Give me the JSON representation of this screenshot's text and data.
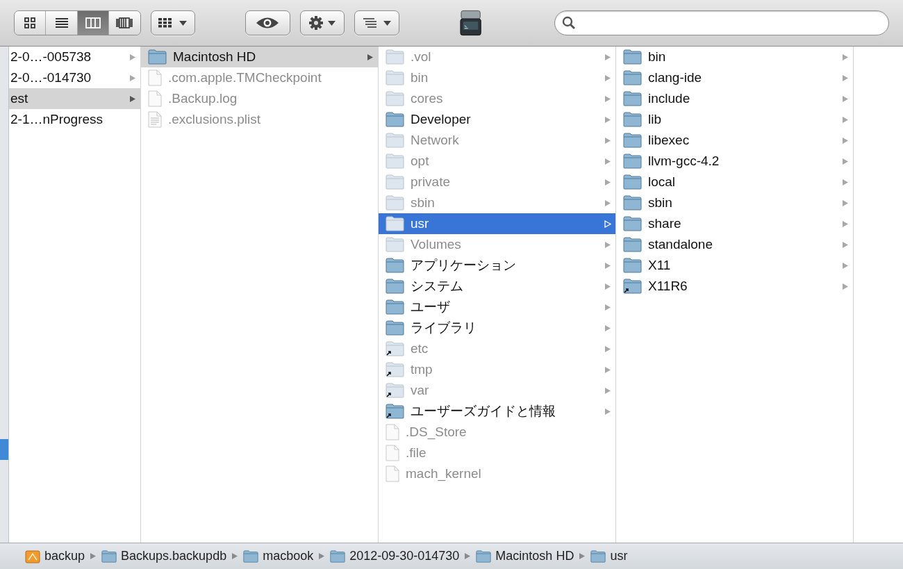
{
  "toolbar": {
    "view_buttons": [
      {
        "kind": "icons",
        "selected": false
      },
      {
        "kind": "list",
        "selected": false
      },
      {
        "kind": "columns",
        "selected": true
      },
      {
        "kind": "coverflow",
        "selected": false
      }
    ]
  },
  "columns": [
    {
      "focused": false,
      "items": [
        {
          "name": "2-0…-005738",
          "kind": "none",
          "dimmed": false,
          "selected": false,
          "arrow": true
        },
        {
          "name": "2-0…-014730",
          "kind": "none",
          "dimmed": false,
          "selected": false,
          "arrow": true
        },
        {
          "name": "est",
          "kind": "none",
          "dimmed": false,
          "selected": true,
          "arrow": true
        },
        {
          "name": "2-1…nProgress",
          "kind": "none",
          "dimmed": false,
          "selected": false,
          "arrow": false
        }
      ]
    },
    {
      "focused": false,
      "items": [
        {
          "name": "Macintosh HD",
          "kind": "folder",
          "dimmed": false,
          "selected": true,
          "arrow": true
        },
        {
          "name": ".com.apple.TMCheckpoint",
          "kind": "file",
          "dimmed": true,
          "selected": false,
          "arrow": false
        },
        {
          "name": ".Backup.log",
          "kind": "file",
          "dimmed": true,
          "selected": false,
          "arrow": false
        },
        {
          "name": ".exclusions.plist",
          "kind": "document",
          "dimmed": true,
          "selected": false,
          "arrow": false
        }
      ]
    },
    {
      "focused": true,
      "items": [
        {
          "name": ".vol",
          "kind": "folder",
          "dimmed": true,
          "selected": false,
          "arrow": true
        },
        {
          "name": "bin",
          "kind": "folder",
          "dimmed": true,
          "selected": false,
          "arrow": true
        },
        {
          "name": "cores",
          "kind": "folder",
          "dimmed": true,
          "selected": false,
          "arrow": true
        },
        {
          "name": "Developer",
          "kind": "folder",
          "dimmed": false,
          "selected": false,
          "arrow": true
        },
        {
          "name": "Network",
          "kind": "folder",
          "dimmed": true,
          "selected": false,
          "arrow": true
        },
        {
          "name": "opt",
          "kind": "folder",
          "dimmed": true,
          "selected": false,
          "arrow": true
        },
        {
          "name": "private",
          "kind": "folder",
          "dimmed": true,
          "selected": false,
          "arrow": true
        },
        {
          "name": "sbin",
          "kind": "folder",
          "dimmed": true,
          "selected": false,
          "arrow": true
        },
        {
          "name": "usr",
          "kind": "folder",
          "dimmed": true,
          "selected": true,
          "arrow": true
        },
        {
          "name": "Volumes",
          "kind": "folder",
          "dimmed": true,
          "selected": false,
          "arrow": true
        },
        {
          "name": "アプリケーション",
          "kind": "folder",
          "dimmed": false,
          "selected": false,
          "arrow": true
        },
        {
          "name": "システム",
          "kind": "folder",
          "dimmed": false,
          "selected": false,
          "arrow": true
        },
        {
          "name": "ユーザ",
          "kind": "folder",
          "dimmed": false,
          "selected": false,
          "arrow": true
        },
        {
          "name": "ライブラリ",
          "kind": "folder",
          "dimmed": false,
          "selected": false,
          "arrow": true
        },
        {
          "name": "etc",
          "kind": "alias",
          "dimmed": true,
          "selected": false,
          "arrow": true
        },
        {
          "name": "tmp",
          "kind": "alias",
          "dimmed": true,
          "selected": false,
          "arrow": true
        },
        {
          "name": "var",
          "kind": "alias",
          "dimmed": true,
          "selected": false,
          "arrow": true
        },
        {
          "name": "ユーザーズガイドと情報",
          "kind": "alias",
          "dimmed": false,
          "selected": false,
          "arrow": true
        },
        {
          "name": ".DS_Store",
          "kind": "file",
          "dimmed": true,
          "selected": false,
          "arrow": false
        },
        {
          "name": ".file",
          "kind": "file",
          "dimmed": true,
          "selected": false,
          "arrow": false
        },
        {
          "name": "mach_kernel",
          "kind": "file",
          "dimmed": true,
          "selected": false,
          "arrow": false
        }
      ]
    },
    {
      "items": [
        {
          "name": "bin",
          "kind": "folder",
          "dimmed": false,
          "selected": false,
          "arrow": true
        },
        {
          "name": "clang-ide",
          "kind": "folder",
          "dimmed": false,
          "selected": false,
          "arrow": true
        },
        {
          "name": "include",
          "kind": "folder",
          "dimmed": false,
          "selected": false,
          "arrow": true
        },
        {
          "name": "lib",
          "kind": "folder",
          "dimmed": false,
          "selected": false,
          "arrow": true
        },
        {
          "name": "libexec",
          "kind": "folder",
          "dimmed": false,
          "selected": false,
          "arrow": true
        },
        {
          "name": "llvm-gcc-4.2",
          "kind": "folder",
          "dimmed": false,
          "selected": false,
          "arrow": true
        },
        {
          "name": "local",
          "kind": "folder",
          "dimmed": false,
          "selected": false,
          "arrow": true
        },
        {
          "name": "sbin",
          "kind": "folder",
          "dimmed": false,
          "selected": false,
          "arrow": true
        },
        {
          "name": "share",
          "kind": "folder",
          "dimmed": false,
          "selected": false,
          "arrow": true
        },
        {
          "name": "standalone",
          "kind": "folder",
          "dimmed": false,
          "selected": false,
          "arrow": true
        },
        {
          "name": "X11",
          "kind": "folder",
          "dimmed": false,
          "selected": false,
          "arrow": true
        },
        {
          "name": "X11R6",
          "kind": "alias",
          "dimmed": false,
          "selected": false,
          "arrow": true
        }
      ]
    }
  ],
  "path_bar": [
    {
      "name": "backup",
      "kind": "disk"
    },
    {
      "name": "Backups.backupdb",
      "kind": "folder"
    },
    {
      "name": "macbook",
      "kind": "folder"
    },
    {
      "name": "2012-09-30-014730",
      "kind": "folder"
    },
    {
      "name": "Macintosh HD",
      "kind": "folder"
    },
    {
      "name": "usr",
      "kind": "folder"
    }
  ]
}
